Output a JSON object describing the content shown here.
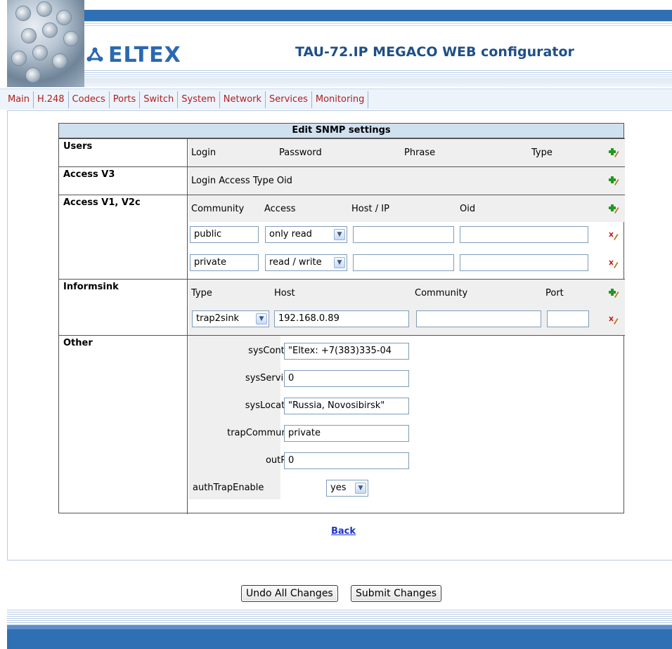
{
  "header": {
    "brand": "ELTEX",
    "title": "TAU-72.IP MEGACO WEB configurator"
  },
  "nav": [
    "Main",
    "H.248",
    "Codecs",
    "Ports",
    "Switch",
    "System",
    "Network",
    "Services",
    "Monitoring"
  ],
  "snmp": {
    "title": "Edit SNMP settings",
    "users": {
      "label": "Users",
      "columns": [
        "Login",
        "Password",
        "Phrase",
        "Type"
      ]
    },
    "access_v3": {
      "label": "Access V3",
      "columns_text": "Login Access Type Oid"
    },
    "access_v1v2c": {
      "label": "Access V1, V2c",
      "columns": [
        "Community",
        "Access",
        "Host / IP",
        "Oid"
      ],
      "rows": [
        {
          "community": "public",
          "access": "only read",
          "host": "",
          "oid": ""
        },
        {
          "community": "private",
          "access": "read / write",
          "host": "",
          "oid": ""
        }
      ]
    },
    "informsink": {
      "label": "Informsink",
      "columns": [
        "Type",
        "Host",
        "Community",
        "Port"
      ],
      "row": {
        "type": "trap2sink",
        "host": "192.168.0.89",
        "community": "",
        "port": ""
      }
    },
    "other": {
      "label": "Other",
      "sysContact_label": "sysContact",
      "sysContact_value": "\"Eltex: +7(383)335-04",
      "sysServices_label": "sysServices",
      "sysServices_value": "0",
      "sysLocation_label": "sysLocation",
      "sysLocation_value": "\"Russia, Novosibirsk\"",
      "trapCommunity_label": "trapCommunity",
      "trapCommunity_value": "private",
      "outPort_label": "outPort",
      "outPort_value": "0",
      "authTrapEnable_label": "authTrapEnable",
      "authTrapEnable_value": "yes"
    }
  },
  "back_link": "Back",
  "buttons": {
    "undo": "Undo All Changes",
    "submit": "Submit Changes"
  },
  "colors": {
    "brand_blue": "#2a69b0",
    "band_blue": "#2f6fb3",
    "nav_link": "#b01e1e",
    "section_header": "#cfe0ef",
    "link_blue": "#1b35c9"
  },
  "icons": {
    "add": "add-row-icon",
    "delete": "delete-row-icon",
    "dropdown": "chevron-down-icon"
  }
}
